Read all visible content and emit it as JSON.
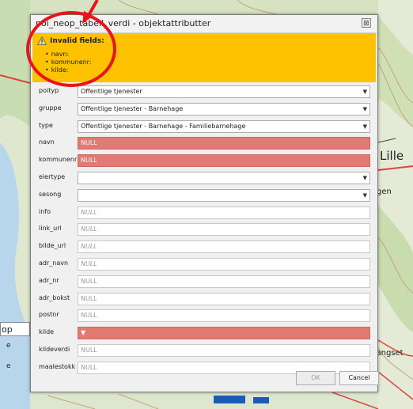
{
  "dialog": {
    "title": "poi_neop_tabell_verdi - objektattributter",
    "close_glyph": "⊠"
  },
  "warning": {
    "title": "Invalid fields:",
    "fields": [
      "navn:",
      "kommunenr:",
      "kilde:"
    ]
  },
  "form": {
    "fields": [
      {
        "label": "poityp",
        "kind": "combo",
        "value": "Offentlige tjenester"
      },
      {
        "label": "gruppe",
        "kind": "combo",
        "value": "Offentlige tjenester - Barnehage"
      },
      {
        "label": "type",
        "kind": "combo",
        "value": "Offentlige tjenester - Barnehage - Familiebarnehage"
      },
      {
        "label": "navn",
        "kind": "invalid",
        "value": "NULL"
      },
      {
        "label": "kommunenr",
        "kind": "invalid",
        "value": "NULL"
      },
      {
        "label": "eiertype",
        "kind": "combo",
        "value": ""
      },
      {
        "label": "sesong",
        "kind": "combo",
        "value": ""
      },
      {
        "label": "info",
        "kind": "text-ph",
        "value": "NULL"
      },
      {
        "label": "link_url",
        "kind": "text-ph",
        "value": "NULL"
      },
      {
        "label": "bilde_url",
        "kind": "text-ph",
        "value": "NULL"
      },
      {
        "label": "adr_navn",
        "kind": "text-ph",
        "value": "NULL"
      },
      {
        "label": "adr_nr",
        "kind": "text",
        "value": "NULL"
      },
      {
        "label": "adr_bokst",
        "kind": "text",
        "value": "NULL"
      },
      {
        "label": "postnr",
        "kind": "text",
        "value": "NULL"
      },
      {
        "label": "kilde",
        "kind": "invalid-combo",
        "value": ""
      },
      {
        "label": "kildeverdi",
        "kind": "text",
        "value": "NULL"
      },
      {
        "label": "maalestokk",
        "kind": "text",
        "value": "NULL"
      }
    ]
  },
  "buttons": {
    "ok": "OK",
    "cancel": "Cancel"
  },
  "map": {
    "label_lille": "Lille",
    "label_gen": "gen",
    "label_cangset": "cangset",
    "label_op": "op",
    "label_e1": "e",
    "label_e2": "e"
  },
  "colors": {
    "warning_bg": "#fec200",
    "invalid_bg": "#e07a72",
    "annotation": "#e8141b"
  }
}
